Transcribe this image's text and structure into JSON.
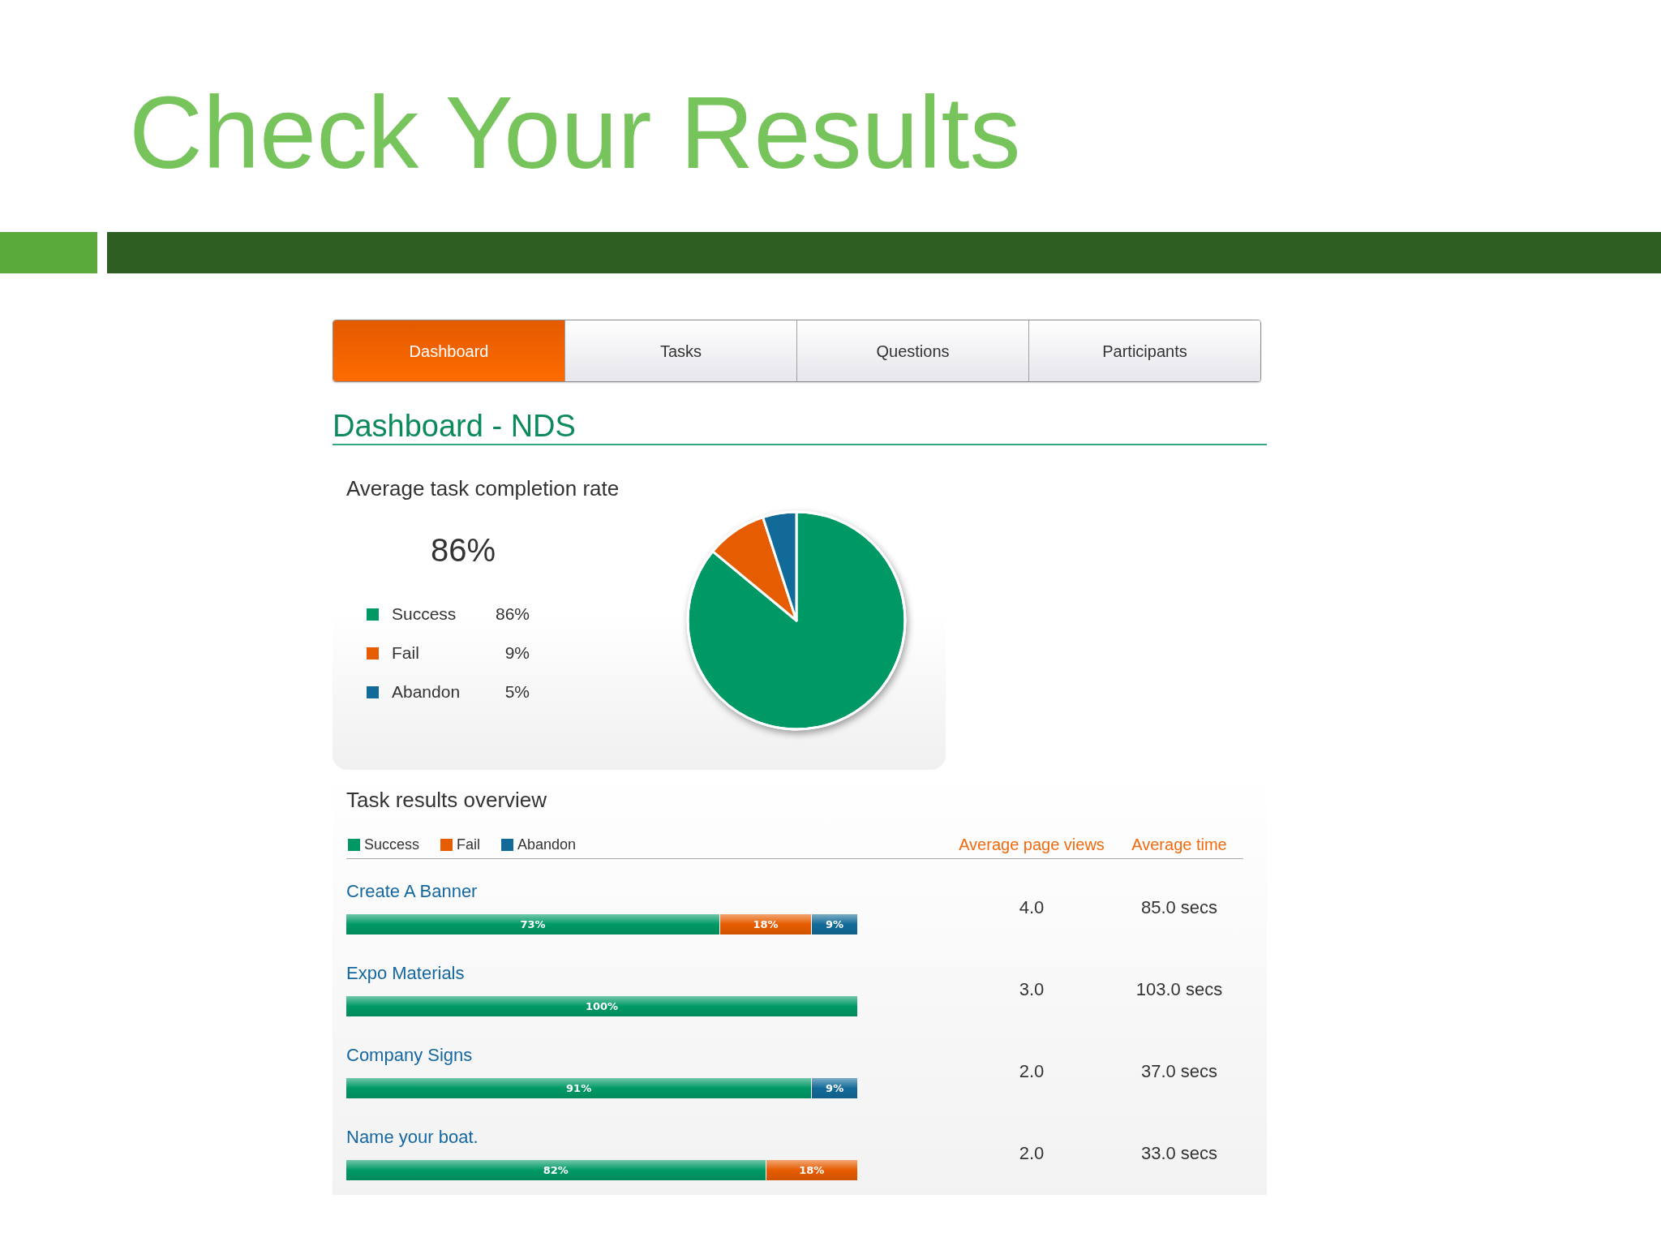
{
  "slide": {
    "title": "Check Your Results"
  },
  "tabs": [
    {
      "label": "Dashboard",
      "selected": true
    },
    {
      "label": "Tasks",
      "selected": false
    },
    {
      "label": "Questions",
      "selected": false
    },
    {
      "label": "Participants",
      "selected": false
    }
  ],
  "page_heading": "Dashboard - NDS",
  "completion": {
    "title": "Average task completion rate",
    "rate": "86%",
    "chart_data": {
      "type": "pie",
      "categories": [
        "Success",
        "Fail",
        "Abandon"
      ],
      "values": [
        86,
        9,
        5
      ]
    },
    "legend": [
      {
        "value": "86%",
        "color": "#009966"
      },
      {
        "value": "9%",
        "color": "#e65c00"
      },
      {
        "value": "5%",
        "color": "#126a98"
      }
    ]
  },
  "task_results": {
    "title": "Task results overview",
    "columns": [
      "Average page views",
      "Average time"
    ],
    "chart_data": {
      "type": "bar",
      "orientation": "horizontal",
      "stacked": true,
      "categories": [
        "Create A Banner",
        "Expo Materials",
        "Company Signs",
        "Name your boat."
      ],
      "series": [
        {
          "name": "Success",
          "color": "#009966",
          "values": [
            73,
            100,
            91,
            82
          ],
          "value_labels": [
            "73%",
            "100%",
            "91%",
            "82%"
          ]
        },
        {
          "name": "Fail",
          "color": "#e65c00",
          "values": [
            18,
            0,
            0,
            18
          ],
          "value_labels": [
            "18%",
            null,
            null,
            "18%"
          ]
        },
        {
          "name": "Abandon",
          "color": "#126a98",
          "values": [
            9,
            0,
            9,
            0
          ],
          "value_labels": [
            "9%",
            null,
            "9%",
            null
          ]
        }
      ]
    },
    "rows": [
      {
        "page_views": "4.0",
        "time": "85.0 secs"
      },
      {
        "page_views": "3.0",
        "time": "103.0 secs"
      },
      {
        "page_views": "2.0",
        "time": "37.0 secs"
      },
      {
        "page_views": "2.0",
        "time": "33.0 secs"
      }
    ]
  }
}
